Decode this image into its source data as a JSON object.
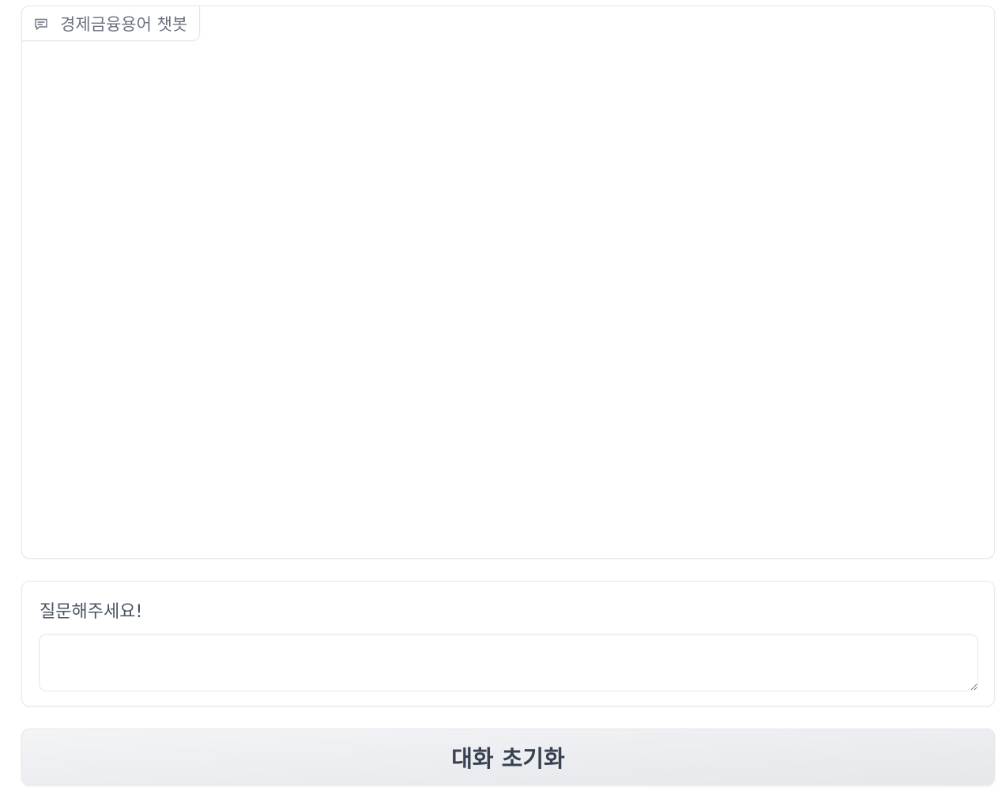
{
  "chatbot": {
    "label": "경제금융용어 챗봇",
    "icon": "chat-bubble-icon",
    "messages": []
  },
  "input": {
    "label": "질문해주세요!",
    "value": "",
    "placeholder": ""
  },
  "reset_button": {
    "label": "대화 초기화"
  },
  "colors": {
    "border": "#e5e7eb",
    "label_text": "#6b7280",
    "button_text": "#374151",
    "button_bg_from": "#f3f4f6",
    "button_bg_to": "#e5e7eb"
  }
}
